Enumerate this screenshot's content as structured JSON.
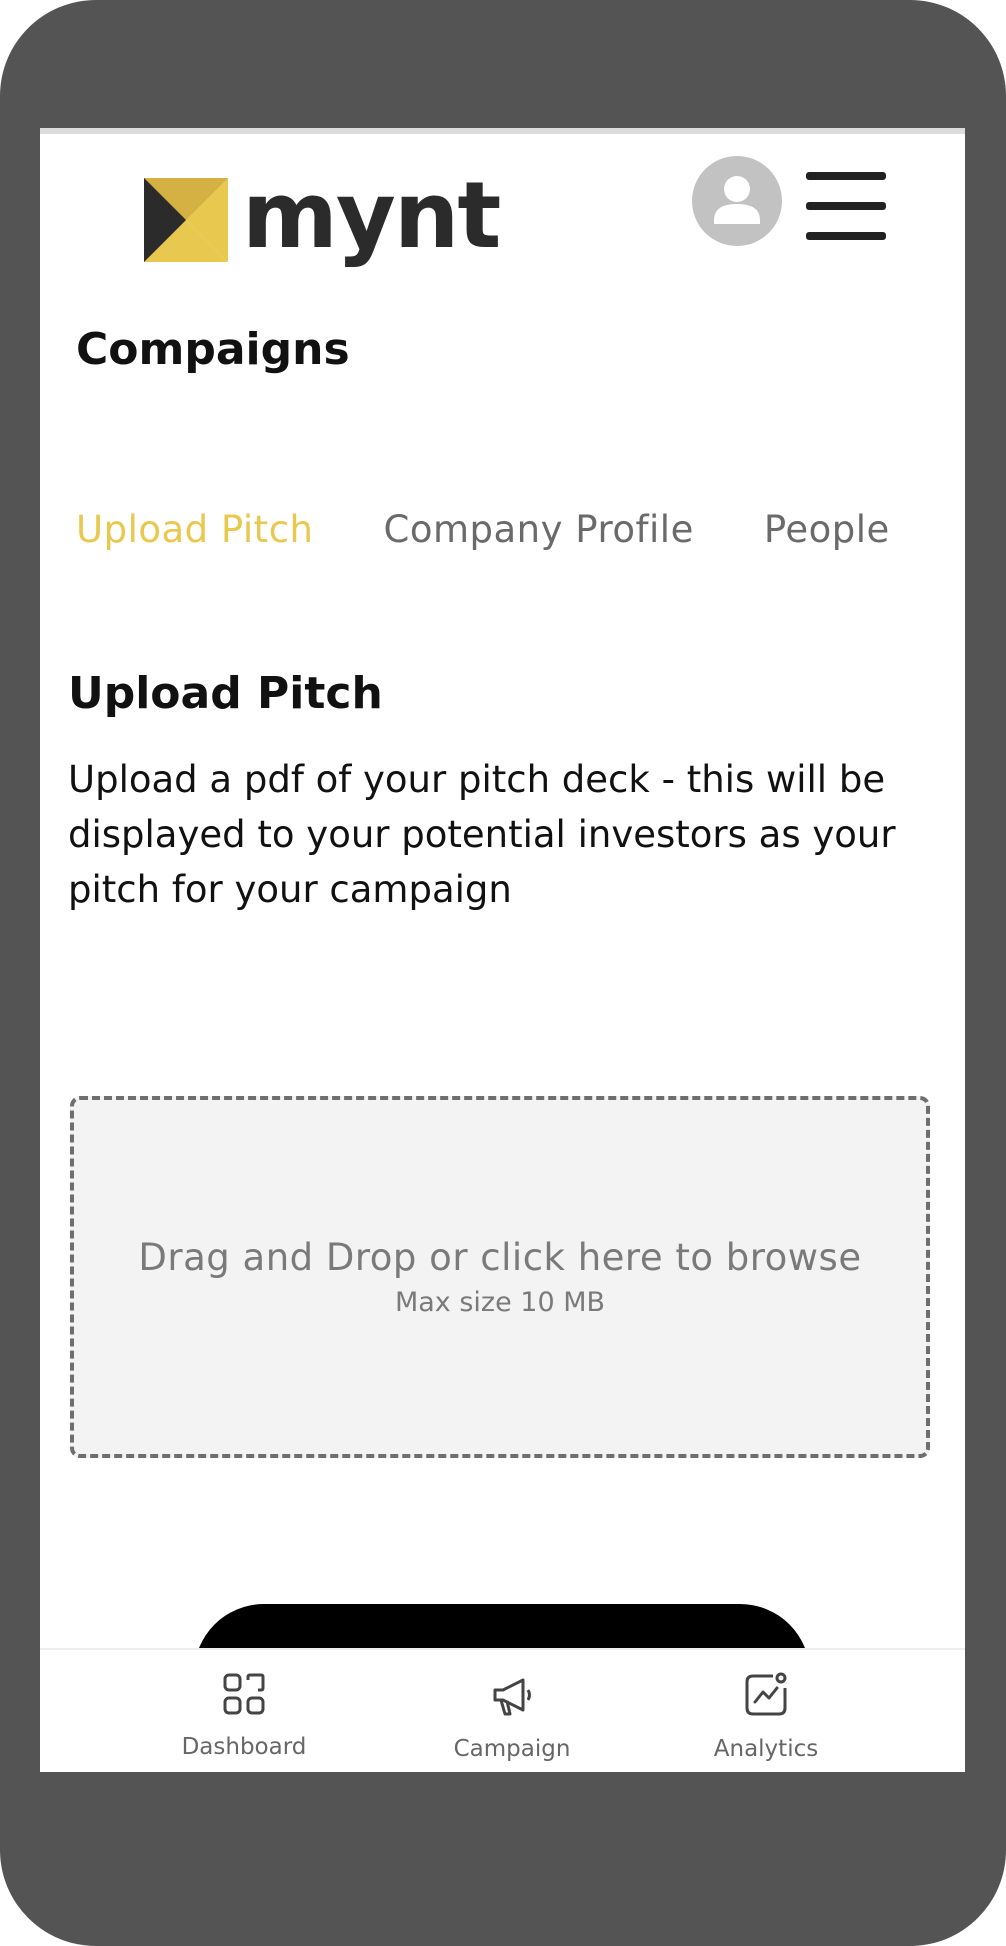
{
  "header": {
    "logo_text": "mynt",
    "brand_color": "#e9c84f",
    "avatar_icon": "user-avatar-icon",
    "menu_icon": "hamburger-menu-icon"
  },
  "page_title": "Compaigns",
  "tabs": [
    {
      "label": "Upload Pitch",
      "active": true
    },
    {
      "label": "Company Profile",
      "active": false
    },
    {
      "label": "People",
      "active": false
    }
  ],
  "section": {
    "title": "Upload Pitch",
    "description": "Upload a pdf of your pitch deck - this will be displayed to your potential investors as your pitch for your campaign"
  },
  "dropzone": {
    "text": "Drag and Drop or click here to browse",
    "subtext": "Max size 10 MB"
  },
  "bottom_nav": [
    {
      "label": "Dashboard",
      "icon": "dashboard-grid-icon"
    },
    {
      "label": "Campaign",
      "icon": "megaphone-icon"
    },
    {
      "label": "Analytics",
      "icon": "analytics-chart-icon"
    }
  ]
}
